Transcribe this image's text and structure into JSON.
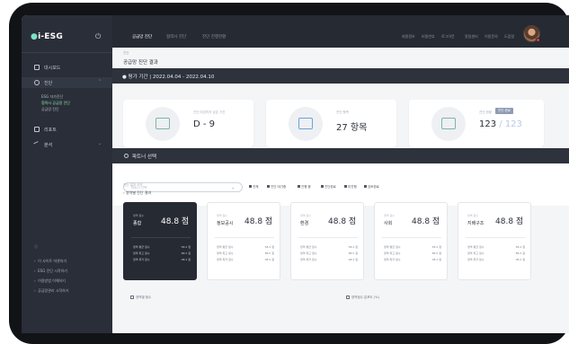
{
  "brand": {
    "text": "i-ESG"
  },
  "sidebar": {
    "items": [
      {
        "label": "대시보드",
        "icon": "grid-icon"
      },
      {
        "label": "진단",
        "icon": "check-circle-icon"
      },
      {
        "label": "리포트",
        "icon": "document-icon"
      },
      {
        "label": "분석",
        "icon": "trend-icon"
      }
    ],
    "subitems": [
      "ESG 자가진단",
      "협력사 공급망 진단",
      "공급망 진단"
    ],
    "bottom_links": [
      "이 사이트 약관하기",
      "ESG 진단 시작하기",
      "이용방법 이해하기",
      "공급망관리 시작하기"
    ]
  },
  "topbar": {
    "tabs": [
      "공급망 진단",
      "협력사 진단",
      "진단 진행현황"
    ],
    "right": [
      "회원정보",
      "비밀번호",
      "로그아웃",
      "알림센터",
      "이용문의",
      "도움말"
    ]
  },
  "main": {
    "crumb": "진단",
    "title": "공급망 진단 결과",
    "period_label": "● 평가 기간 | 2022.04.04 - 2022.04.10",
    "kpis": [
      {
        "label": "진단 마감까지 남은 기간",
        "value": "D - 9",
        "icon": "calendar-icon"
      },
      {
        "label": "진단 항목",
        "value": "27 항목",
        "icon": "chart-icon"
      },
      {
        "label": "진단 현황",
        "value": "123",
        "value2": " / 123",
        "tag": "진단 완료",
        "icon": "report-icon"
      }
    ],
    "partner_label": "파트너 선택",
    "select_placeholder": "파트너 선택",
    "filters": [
      "전체",
      "진단 대기중",
      "진행 중",
      "진단완료",
      "미진행",
      "검토완료"
    ],
    "section_small": "진단 결과 요약",
    "section_title": "› 영역별 진단 결과",
    "cards": [
      {
        "sub": "영역 점수",
        "name": "종합",
        "score": "48.8 점",
        "rows": [
          [
            "영역 평균 점수",
            "58.2 점"
          ],
          [
            "영역 최고 점수",
            "88.5 점"
          ],
          [
            "영역 최저 점수",
            "08.2 점"
          ]
        ]
      },
      {
        "sub": "영역 점수",
        "name": "정보공시",
        "score": "48.8 점",
        "rows": [
          [
            "영역 평균 점수",
            "58.2 점"
          ],
          [
            "영역 최고 점수",
            "88.5 점"
          ],
          [
            "영역 최저 점수",
            "08.2 점"
          ]
        ]
      },
      {
        "sub": "영역 점수",
        "name": "환경",
        "score": "48.8 점",
        "rows": [
          [
            "영역 평균 점수",
            "58.2 점"
          ],
          [
            "영역 최고 점수",
            "88.5 점"
          ],
          [
            "영역 최저 점수",
            "08.2 점"
          ]
        ]
      },
      {
        "sub": "영역 점수",
        "name": "사회",
        "score": "48.8 점",
        "rows": [
          [
            "영역 평균 점수",
            "58.2 점"
          ],
          [
            "영역 최고 점수",
            "88.5 점"
          ],
          [
            "영역 최저 점수",
            "08.2 점"
          ]
        ]
      },
      {
        "sub": "영역 점수",
        "name": "지배구조",
        "score": "48.8 점",
        "rows": [
          [
            "영역 평균 점수",
            "58.2 점"
          ],
          [
            "영역 최고 점수",
            "88.5 점"
          ],
          [
            "영역 최저 점수",
            "08.2 점"
          ]
        ]
      }
    ],
    "bottom": [
      "영역별 점수",
      "영역점수 분포도 (%)"
    ]
  }
}
